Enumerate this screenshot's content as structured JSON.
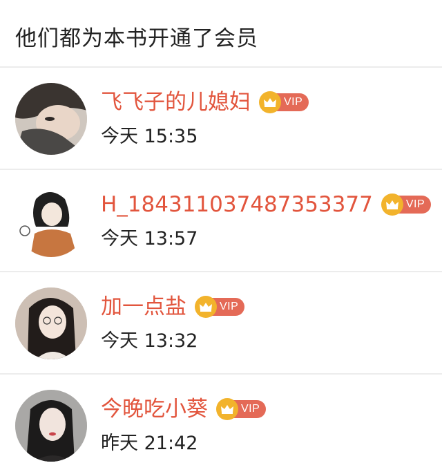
{
  "header": {
    "title": "他们都为本书开通了会员"
  },
  "members": [
    {
      "name": "飞飞子的儿媳妇",
      "badge": "VIP",
      "time": "今天 15:35"
    },
    {
      "name": "H_184311037487353377",
      "badge": "VIP",
      "time": "今天 13:57"
    },
    {
      "name": "加一点盐",
      "badge": "VIP",
      "time": "今天 13:32"
    },
    {
      "name": "今晚吃小葵",
      "badge": "VIP",
      "time": "昨天 21:42"
    }
  ],
  "colors": {
    "name": "#e2553d",
    "vip_tag": "#e46a57",
    "vip_crown": "#f2b32c",
    "divider": "#ececec"
  }
}
